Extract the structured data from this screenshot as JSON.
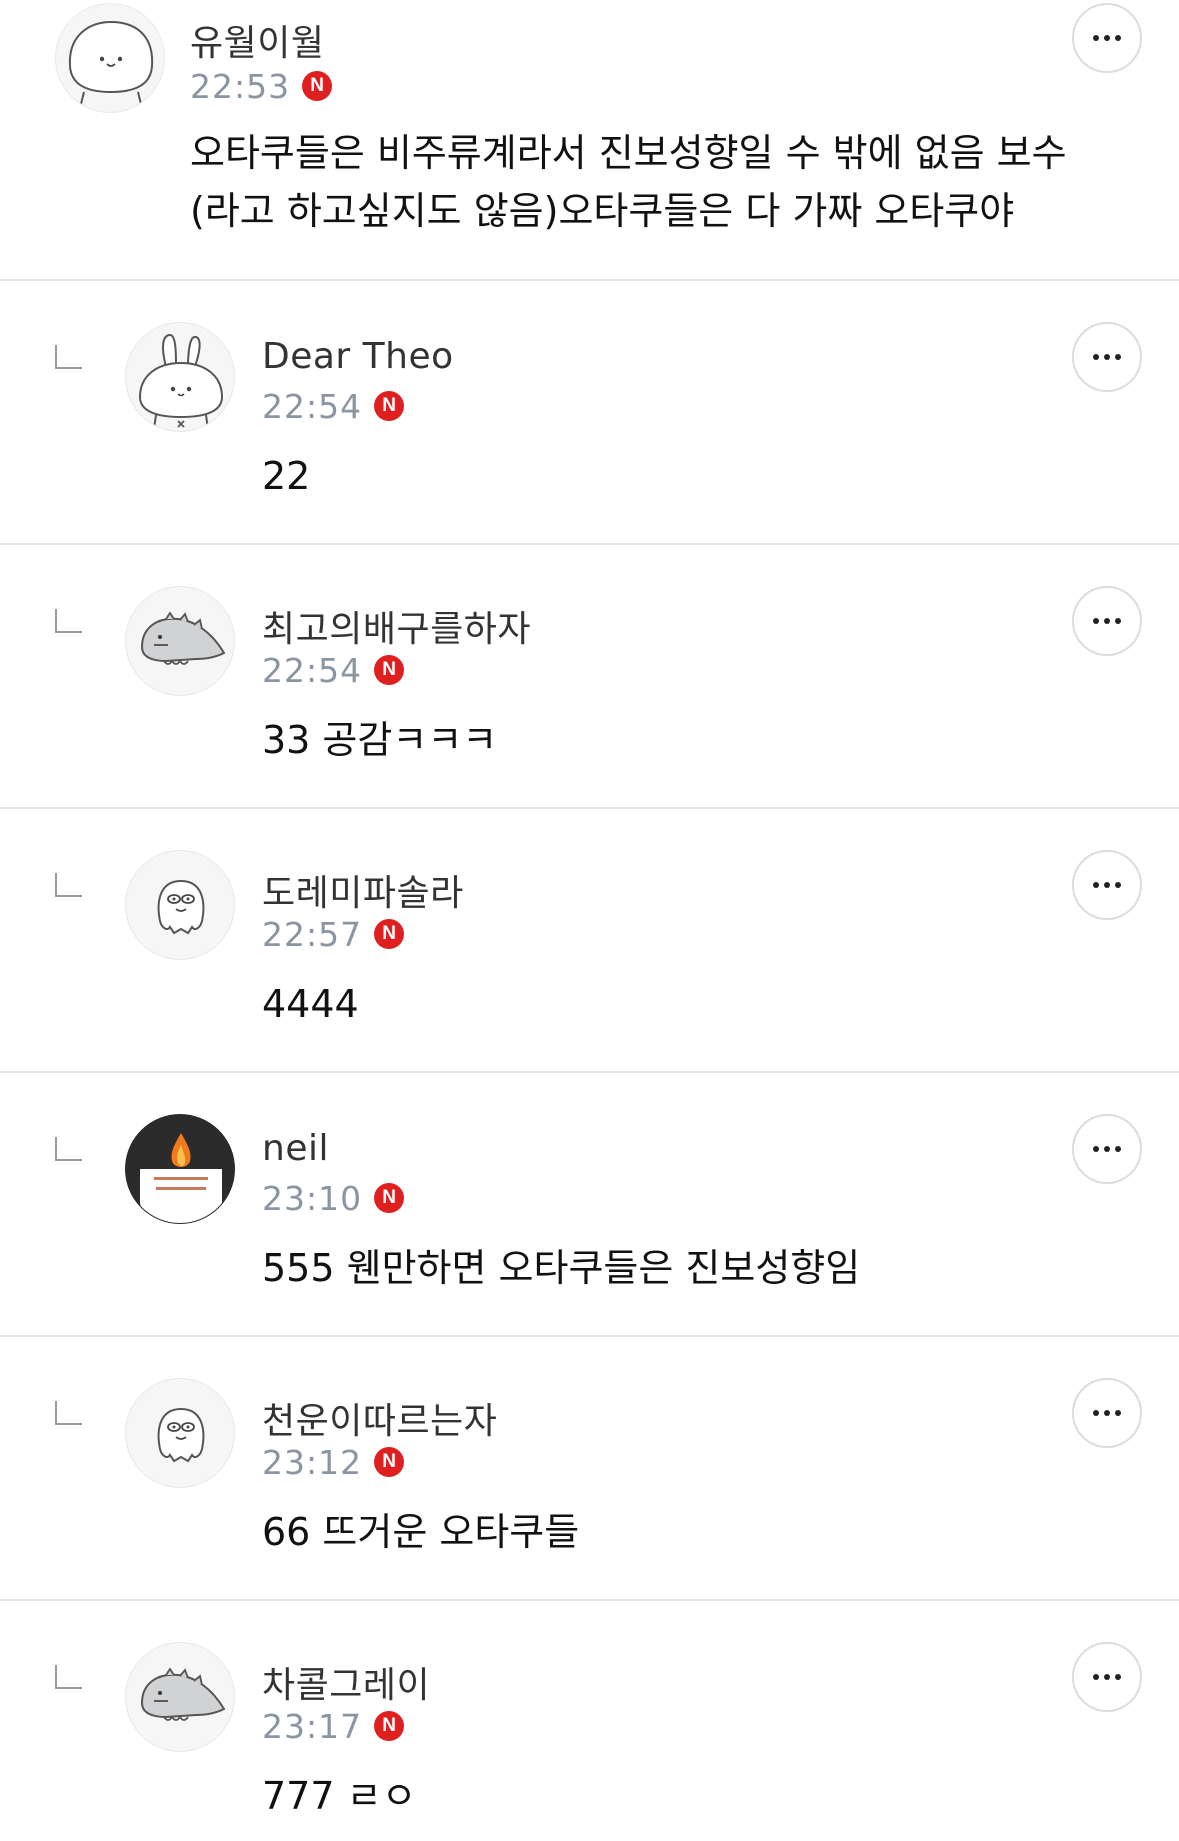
{
  "comments": [
    {
      "author": "유월이월",
      "time": "22:53",
      "badge": "N",
      "text": "오타쿠들은 비주류계라서 진보성향일 수 밖에 없음 보수\n(라고 하고싶지도 않음)오타쿠들은 다 가짜 오타쿠야",
      "avatar_icon": "round-face-icon",
      "reply": false
    },
    {
      "author": "Dear Theo",
      "time": "22:54",
      "badge": "N",
      "text": "22",
      "avatar_icon": "rabbit-icon",
      "reply": true
    },
    {
      "author": "최고의배구를하자",
      "time": "22:54",
      "badge": "N",
      "text": "33 공감ㅋㅋㅋ",
      "avatar_icon": "dinosaur-icon",
      "reply": true
    },
    {
      "author": "도레미파솔라",
      "time": "22:57",
      "badge": "N",
      "text": "4444",
      "avatar_icon": "ghost-icon",
      "reply": true
    },
    {
      "author": "neil",
      "time": "23:10",
      "badge": "N",
      "text": "555 웬만하면 오타쿠들은 진보성향임",
      "avatar_icon": "candle-icon",
      "reply": true
    },
    {
      "author": "천운이따르는자",
      "time": "23:12",
      "badge": "N",
      "text": "66 뜨거운 오타쿠들",
      "avatar_icon": "ghost-icon",
      "reply": true
    },
    {
      "author": "차콜그레이",
      "time": "23:17",
      "badge": "N",
      "text": "777 ㄹㅇ",
      "avatar_icon": "dinosaur-icon",
      "reply": true
    }
  ],
  "colors": {
    "badge": "#e02020",
    "time": "#8a95a3",
    "divider": "#e4e4e4"
  }
}
